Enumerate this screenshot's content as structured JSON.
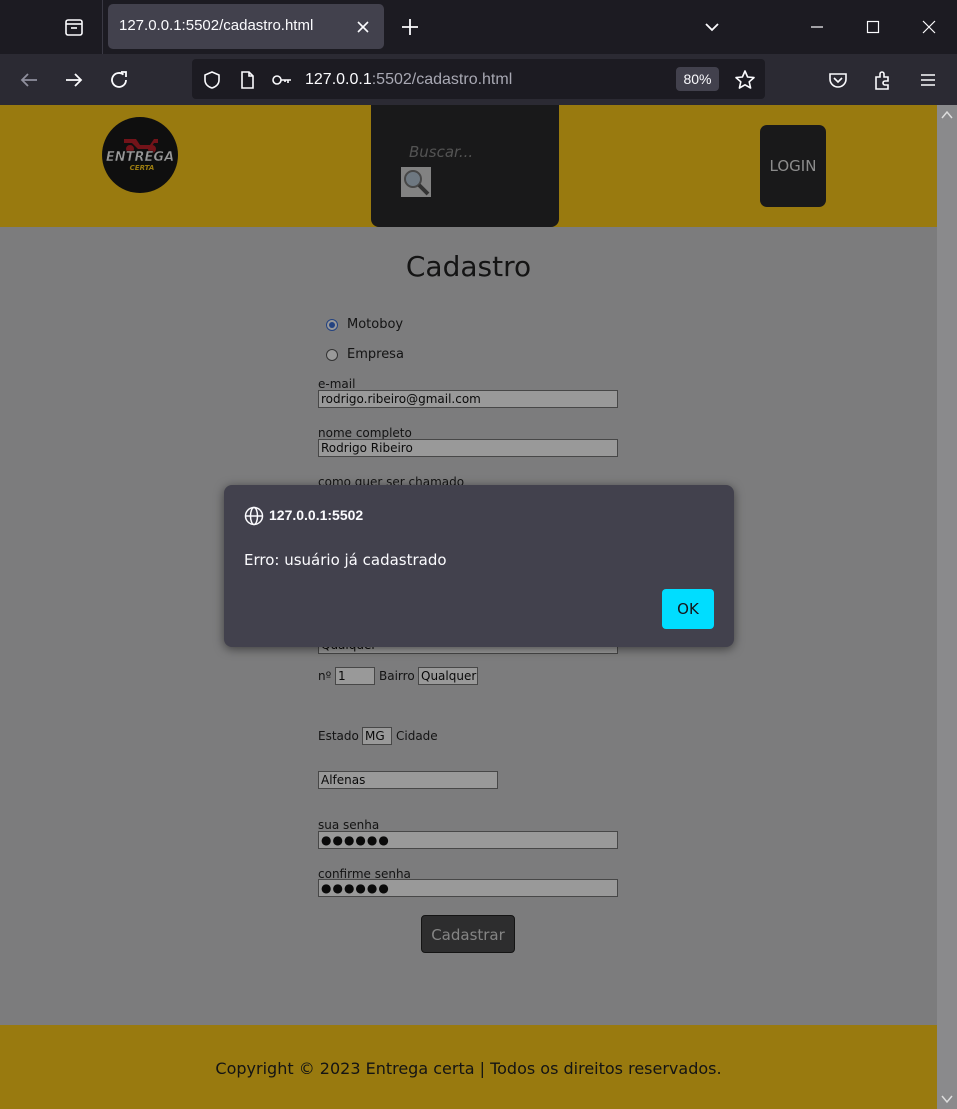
{
  "browser": {
    "tab_title": "127.0.0.1:5502/cadastro.html",
    "url_host": "127.0.0.1",
    "url_rest": ":5502/cadastro.html",
    "zoom": "80%"
  },
  "header": {
    "logo_alt": "Entrega Certa",
    "logo_line1": "ENTREGA",
    "logo_line2": "CERTA",
    "search_placeholder": "Buscar...",
    "login_label": "LOGIN"
  },
  "form": {
    "title": "Cadastro",
    "radio_options": [
      {
        "label": "Motoboy",
        "checked": true
      },
      {
        "label": "Empresa",
        "checked": false
      }
    ],
    "email_label": "e-mail",
    "email_value": "rodrigo.ribeiro@gmail.com",
    "name_label": "nome completo",
    "name_value": "Rodrigo Ribeiro",
    "nickname_label": "como quer ser chamado",
    "street_value": "Qualquer",
    "number_label": "nº",
    "number_value": "1",
    "district_label": "Bairro",
    "district_value": "Qualquer",
    "state_label": "Estado",
    "state_value": "MG",
    "city_label": "Cidade",
    "city_value": "Alfenas",
    "password_label": "sua senha",
    "password_value": "●●●●●●",
    "confirm_label": "confirme senha",
    "confirm_value": "●●●●●●",
    "submit_label": "Cadastrar"
  },
  "footer": {
    "copyright": "Copyright © 2023 Entrega certa | Todos os direitos reservados."
  },
  "dialog": {
    "origin": "127.0.0.1:5502",
    "message": "Erro: usuário já cadastrado",
    "ok_label": "OK"
  },
  "colors": {
    "header_bg": "#ffcc1a",
    "dialog_bg": "#42414d",
    "ok_button": "#00ddff"
  }
}
